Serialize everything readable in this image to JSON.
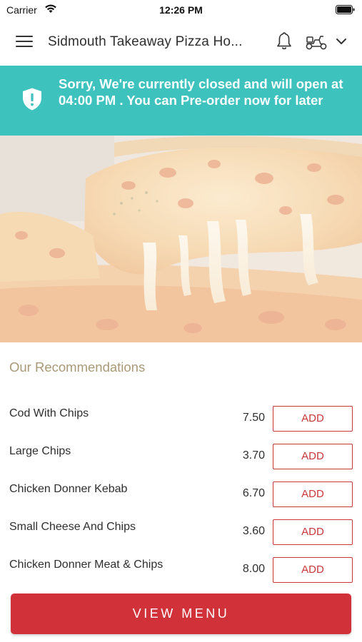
{
  "status_bar": {
    "carrier": "Carrier",
    "time": "12:26 PM",
    "wifi_icon": "wifi-icon",
    "battery_icon": "battery-icon"
  },
  "header": {
    "title": "Sidmouth Takeaway Pizza Ho...",
    "icons": [
      "menu-icon",
      "bell-icon",
      "scooter-icon",
      "chevron-down-icon"
    ]
  },
  "banner": {
    "text": "Sorry, We're currently closed and will open at 04:00 PM . You can Pre-order now for later",
    "color": "#3ec2be",
    "icon": "shield-icon"
  },
  "recommendations": {
    "title": "Our Recommendations",
    "items": [
      {
        "name": "Cod With Chips",
        "price": "7.50",
        "button": "ADD"
      },
      {
        "name": "Large Chips",
        "price": "3.70",
        "button": "ADD"
      },
      {
        "name": "Chicken Donner Kebab",
        "price": "6.70",
        "button": "ADD"
      },
      {
        "name": "Small Cheese And Chips",
        "price": "3.60",
        "button": "ADD"
      },
      {
        "name": "Chicken Donner Meat & Chips",
        "price": "8.00",
        "button": "ADD"
      }
    ]
  },
  "footer": {
    "view_menu_label": "VIEW MENU",
    "accent_color": "#d13239"
  }
}
